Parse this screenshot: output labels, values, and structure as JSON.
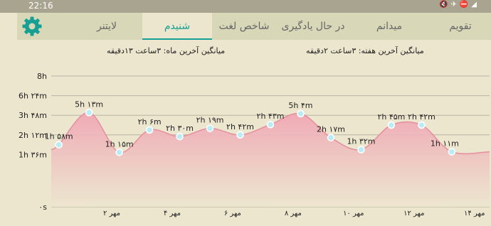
{
  "status_bar": {
    "time": "22:16",
    "icons": [
      "mute-icon",
      "airplane-icon",
      "dnd-icon",
      "signal-icon"
    ]
  },
  "tabs": [
    {
      "id": "calendar",
      "label": "تقویم",
      "active": false
    },
    {
      "id": "field",
      "label": "میدانم",
      "active": false
    },
    {
      "id": "learning",
      "label": "در حال یادگیری",
      "active": false
    },
    {
      "id": "word-index",
      "label": "شاخص لغت",
      "active": false
    },
    {
      "id": "listening",
      "label": "شنیدم",
      "active": true
    },
    {
      "id": "light",
      "label": "لایتنر",
      "active": false
    }
  ],
  "summary": {
    "week": "میانگین آخرین هفته: ۳ساعت ۲دقیقه",
    "month": "میانگین آخرین ماه: ۳ساعت ۱۳دقیقه"
  },
  "colors": {
    "accent": "#16a093",
    "fill_top": "#f0a7b4",
    "fill_bottom": "#ece6cf",
    "point": "#b9ecf5",
    "background": "#ece6cf"
  },
  "chart_data": {
    "type": "area",
    "y_ticks": [
      {
        "value": 0,
        "label": "۰s"
      },
      {
        "value": 96,
        "label": "1h ۳۶m"
      },
      {
        "value": 132,
        "label": "2h ۱۲m"
      },
      {
        "value": 168,
        "label": "3h ۴۸m"
      },
      {
        "value": 204,
        "label": "6h ۲۴m"
      },
      {
        "value": 240,
        "label": "8h"
      }
    ],
    "x_ticks": [
      {
        "x": 2,
        "label": "۲ مهر"
      },
      {
        "x": 4,
        "label": "۴ مهر"
      },
      {
        "x": 6,
        "label": "۶ مهر"
      },
      {
        "x": 8,
        "label": "۸ مهر"
      },
      {
        "x": 10,
        "label": "۱۰ مهر"
      },
      {
        "x": 12,
        "label": "۱۲ مهر"
      },
      {
        "x": 14,
        "label": "۱۴ مهر"
      }
    ],
    "xlim": [
      0,
      14.5
    ],
    "ylim": [
      0,
      240
    ],
    "grid": true,
    "points": [
      {
        "x": 0.25,
        "y": 114,
        "label": "1h ۵۸m"
      },
      {
        "x": 1.25,
        "y": 173,
        "label": "5h ۱۳m"
      },
      {
        "x": 2.25,
        "y": 100,
        "label": "1h ۱۵m"
      },
      {
        "x": 3.25,
        "y": 141,
        "label": "۲h ۶m"
      },
      {
        "x": 4.25,
        "y": 129,
        "label": "۲h ۳۰m"
      },
      {
        "x": 5.25,
        "y": 144,
        "label": "۲h ۱۹m"
      },
      {
        "x": 6.25,
        "y": 132,
        "label": "۲h ۴۲m"
      },
      {
        "x": 7.25,
        "y": 151,
        "label": "۲h ۴۳m"
      },
      {
        "x": 8.25,
        "y": 171,
        "label": "5h ۴m"
      },
      {
        "x": 9.25,
        "y": 127,
        "label": "2h ۱۷m"
      },
      {
        "x": 10.25,
        "y": 105,
        "label": "1h ۳۲m"
      },
      {
        "x": 11.25,
        "y": 150,
        "label": "۲h ۴۵m"
      },
      {
        "x": 12.25,
        "y": 150,
        "label": "۲h ۴۲m"
      },
      {
        "x": 13.25,
        "y": 101,
        "label": "1h ۱۱m"
      }
    ]
  }
}
